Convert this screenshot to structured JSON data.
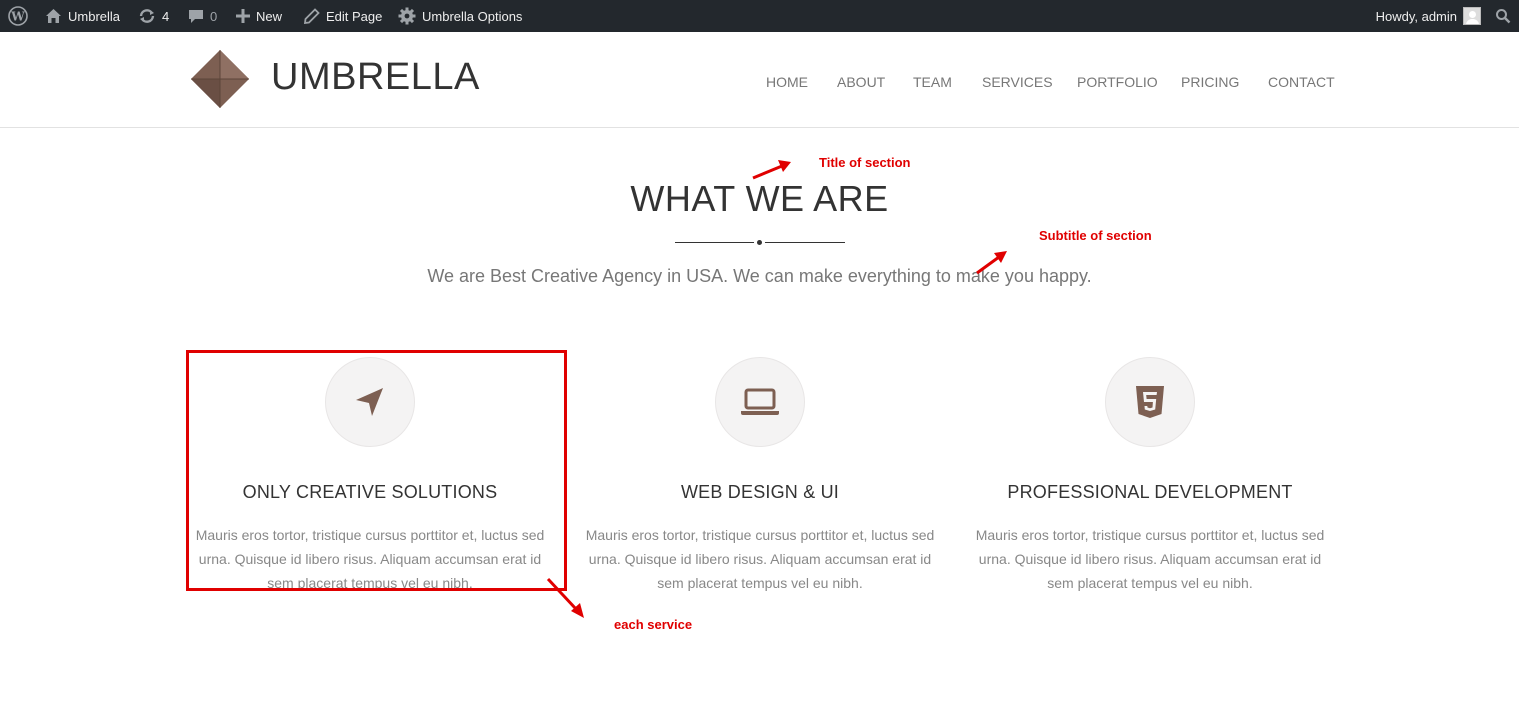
{
  "admin_bar": {
    "site_name": "Umbrella",
    "updates_count": "4",
    "comments_count": "0",
    "new_label": "New",
    "edit_page_label": "Edit Page",
    "options_label": "Umbrella Options",
    "howdy_label": "Howdy, admin"
  },
  "site": {
    "brand": "UMBRELLA",
    "nav": [
      "HOME",
      "ABOUT",
      "TEAM",
      "SERVICES",
      "PORTFOLIO",
      "PRICING",
      "CONTACT"
    ]
  },
  "section": {
    "title": "WHAT WE ARE",
    "subtitle": "We are Best Creative Agency in USA. We can make everything to make you happy."
  },
  "services": [
    {
      "icon": "location-arrow-icon",
      "title": "ONLY CREATIVE SOLUTIONS",
      "text": "Mauris eros tortor, tristique cursus porttitor et, luctus sed urna. Quisque id libero risus. Aliquam accumsan erat id sem placerat tempus vel eu nibh."
    },
    {
      "icon": "laptop-icon",
      "title": "WEB DESIGN & UI",
      "text": "Mauris eros tortor, tristique cursus porttitor et, luctus sed urna. Quisque id libero risus. Aliquam accumsan erat id sem placerat tempus vel eu nibh."
    },
    {
      "icon": "html5-icon",
      "title": "PROFESSIONAL DEVELOPMENT",
      "text": "Mauris eros tortor, tristique cursus porttitor et, luctus sed urna. Quisque id libero risus. Aliquam accumsan erat id sem placerat tempus vel eu nibh."
    }
  ],
  "annotations": {
    "title_note": "Title of section",
    "subtitle_note": "Subtitle of section",
    "service_note": "each service"
  },
  "colors": {
    "accent": "#7d5f52",
    "admin_bar": "#23282d",
    "annotation": "#e00000"
  }
}
